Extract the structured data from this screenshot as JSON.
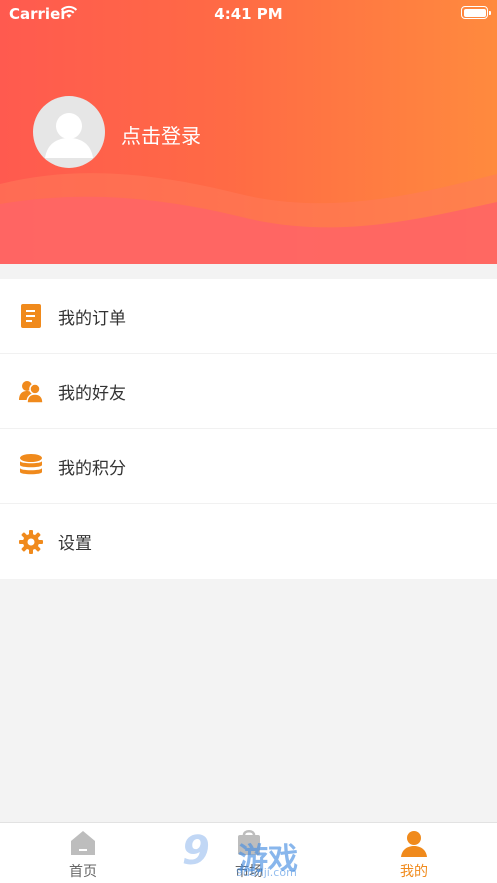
{
  "status_bar": {
    "carrier": "Carrier",
    "time": "4:41 PM"
  },
  "profile": {
    "login_label": "点击登录"
  },
  "menu": {
    "items": [
      {
        "label": "我的订单",
        "icon": "order-icon"
      },
      {
        "label": "我的好友",
        "icon": "friends-icon"
      },
      {
        "label": "我的积分",
        "icon": "points-icon"
      },
      {
        "label": "设置",
        "icon": "gear-icon"
      }
    ]
  },
  "tabbar": {
    "tabs": [
      {
        "label": "首页",
        "icon": "home-icon",
        "active": false
      },
      {
        "label": "市场",
        "icon": "market-icon",
        "active": false
      },
      {
        "label": "我的",
        "icon": "profile-icon",
        "active": true
      }
    ]
  },
  "watermark": {
    "number": "9",
    "text": "游戏",
    "url": "9danji.com"
  },
  "colors": {
    "header_start": "#ff5a4f",
    "header_end": "#ff8a3e",
    "accent": "#f08a1c",
    "background": "#f3f3f3"
  }
}
